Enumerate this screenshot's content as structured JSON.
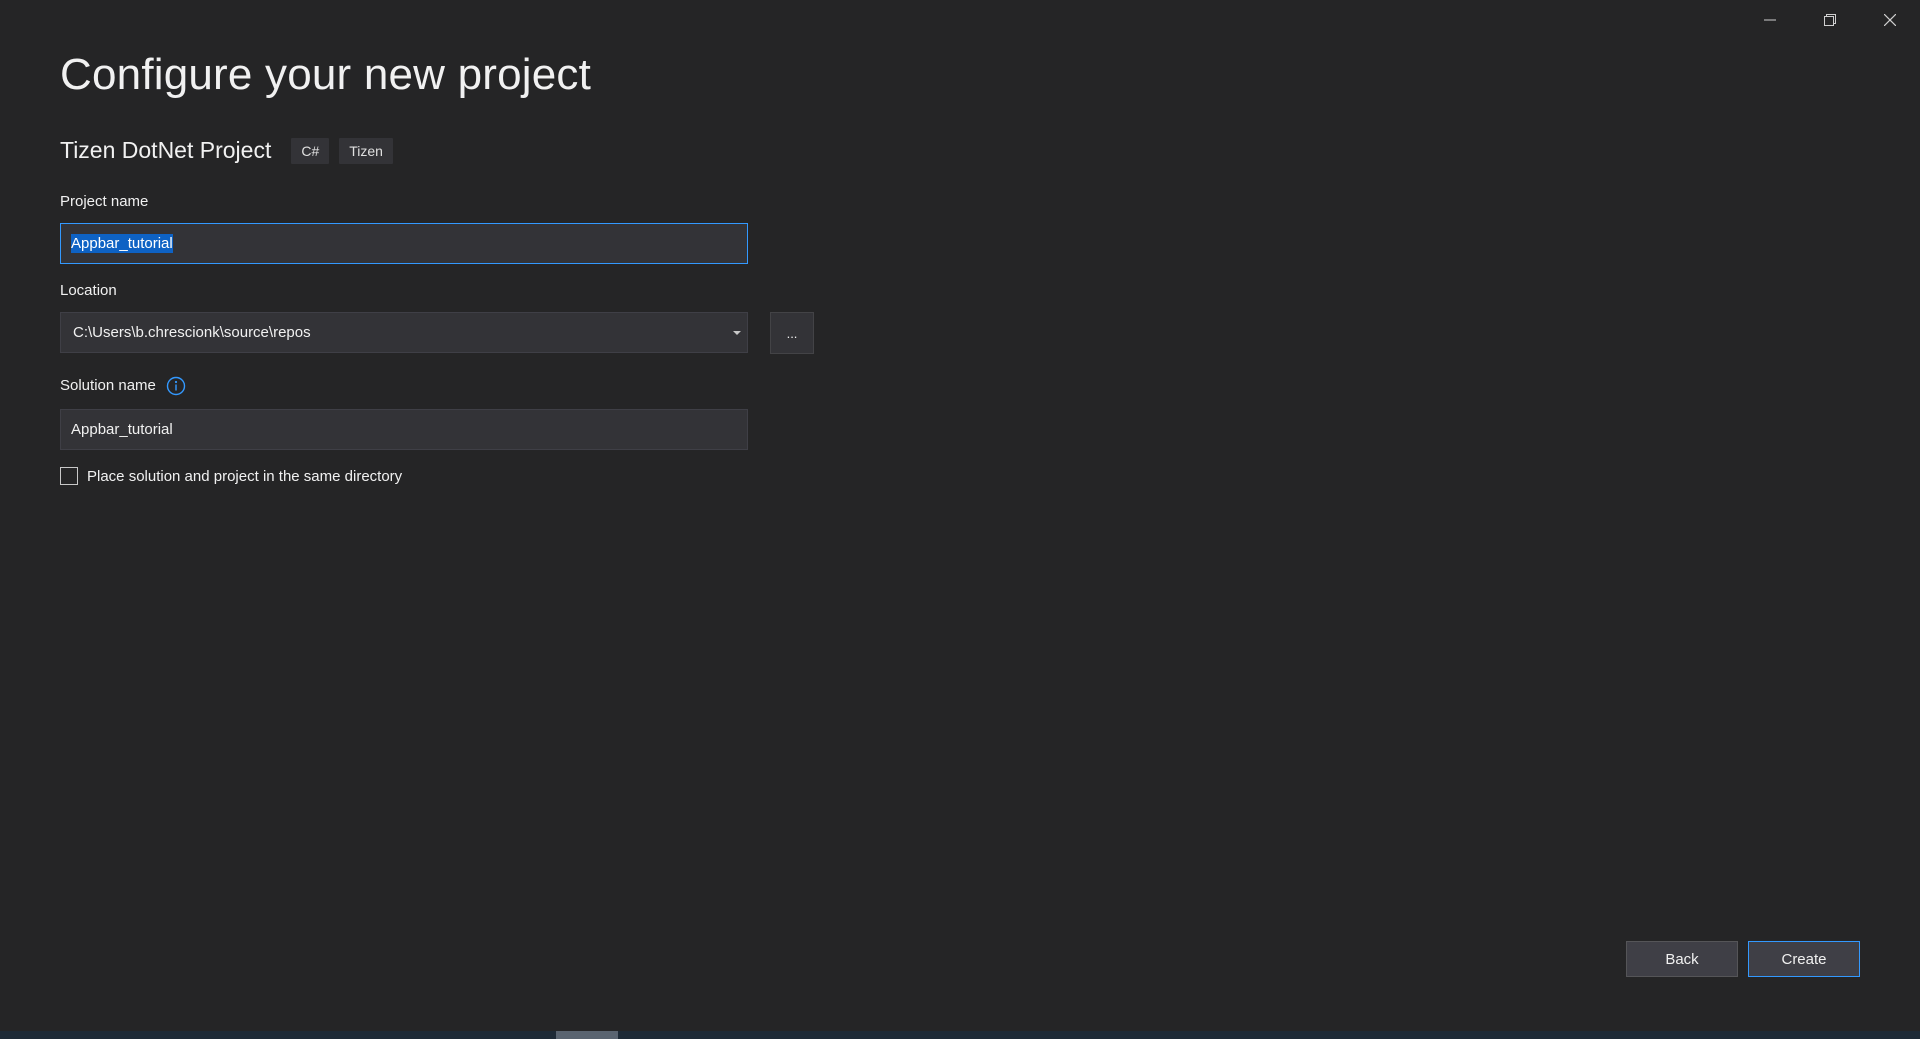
{
  "window": {
    "controls": {
      "minimize_icon": "minimize-icon",
      "restore_icon": "restore-icon",
      "close_icon": "close-icon"
    }
  },
  "header": {
    "title": "Configure your new project"
  },
  "template": {
    "name": "Tizen DotNet Project",
    "tags": [
      "C#",
      "Tizen"
    ]
  },
  "form": {
    "project_name": {
      "label": "Project name",
      "value": "Appbar_tutorial"
    },
    "location": {
      "label": "Location",
      "value": "C:\\Users\\b.chrescionk\\source\\repos",
      "browse_label": "..."
    },
    "solution_name": {
      "label": "Solution name",
      "value": "Appbar_tutorial",
      "info_icon": "info-icon"
    },
    "same_directory": {
      "label": "Place solution and project in the same directory",
      "checked": false
    }
  },
  "footer": {
    "back_label": "Back",
    "create_label": "Create"
  },
  "colors": {
    "background": "#252526",
    "field_background": "#333337",
    "accent": "#3399ff",
    "selection": "#0e62c4"
  }
}
